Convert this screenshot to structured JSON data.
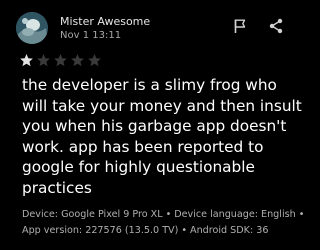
{
  "review": {
    "user_name": "Mister Awesome",
    "date": "Nov 1 13:11",
    "rating": 1,
    "max_rating": 5,
    "body": "the developer is a slimy frog who will take your money and then insult you when his garbage app doesn't work. app has been reported to google for highly questionable practices",
    "avatar_icon": "avatar-photo-icon",
    "actions": {
      "flag_icon": "flag-icon",
      "share_icon": "share-icon"
    }
  },
  "device_info": {
    "device": "Device: Google Pixel 9 Pro XL",
    "language": "Device language: English",
    "app_version": "App version: 227576 (13.5.0 TV)",
    "sdk": "Android SDK: 36",
    "separator": "•"
  },
  "colors": {
    "background": "#000000",
    "text_primary": "#ffffff",
    "text_secondary": "#a8a8a8",
    "star_filled": "#e3e3e3",
    "star_empty": "#3a3a3a"
  }
}
